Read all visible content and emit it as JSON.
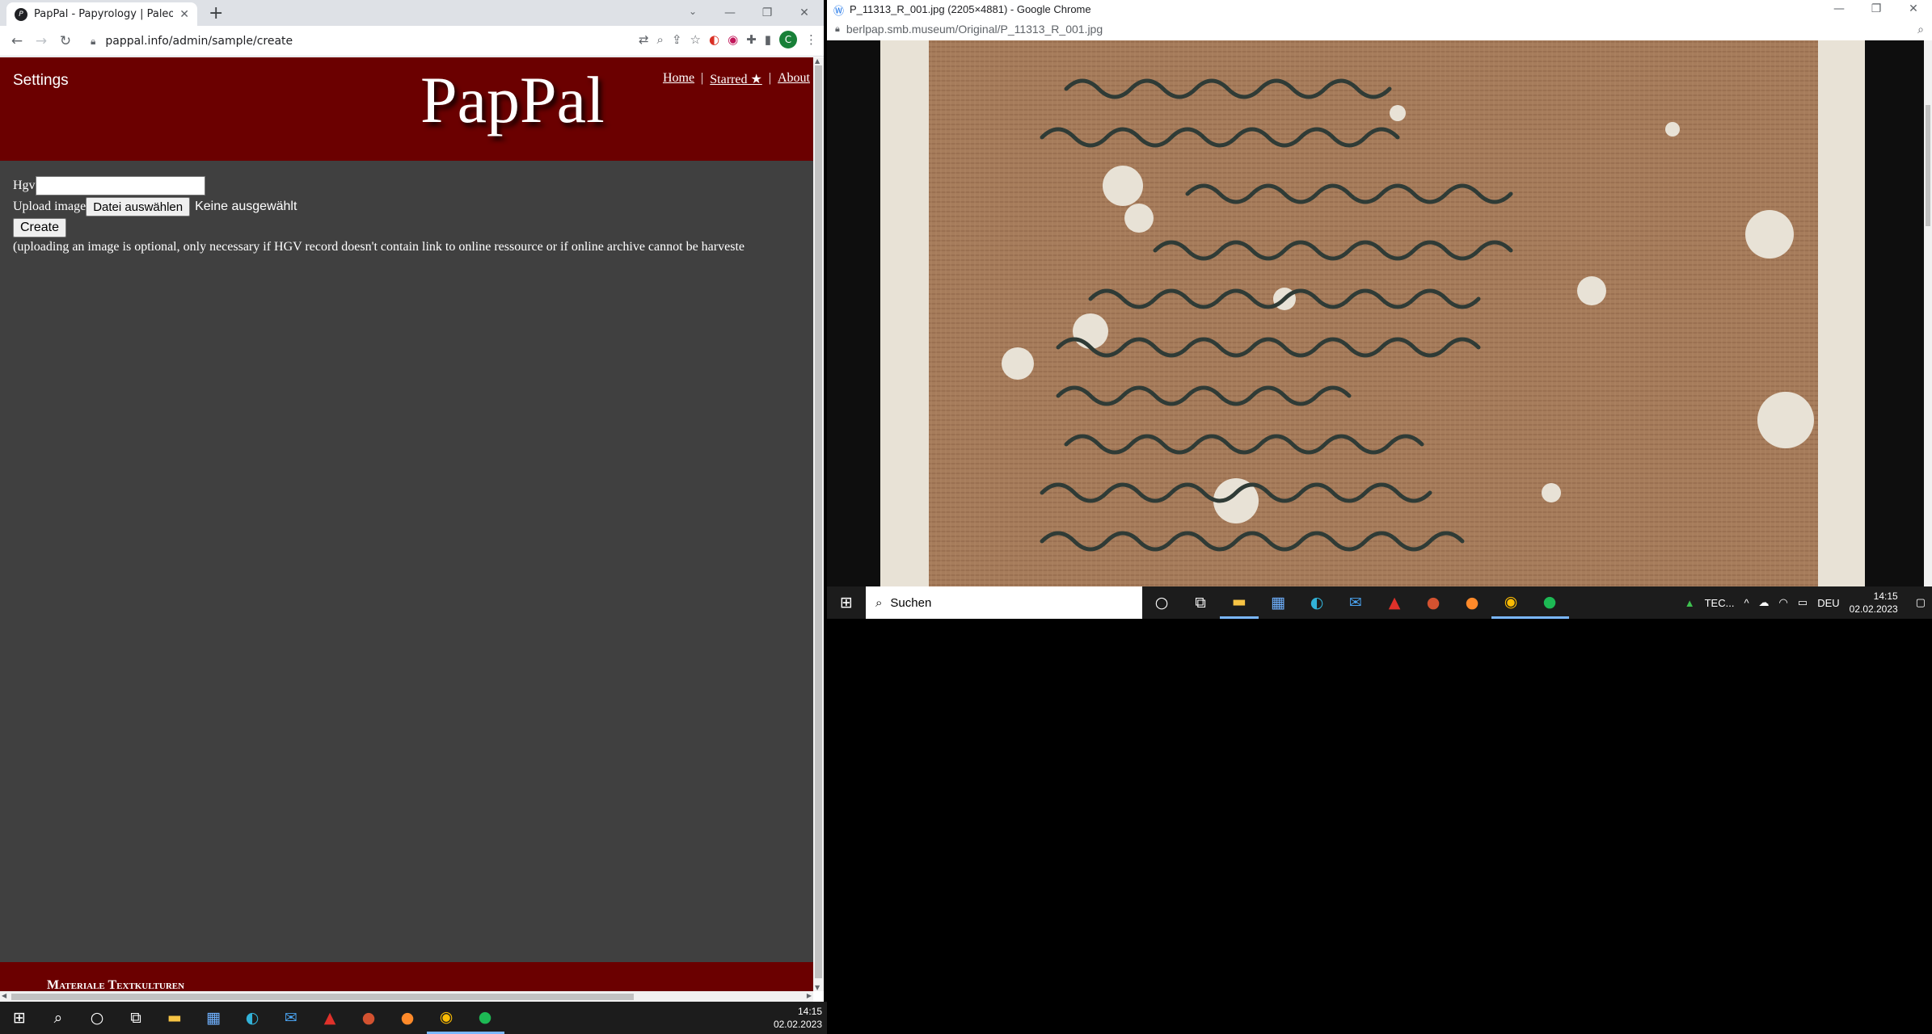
{
  "left_window": {
    "tab_title": "PapPal - Papyrology | Paleography",
    "url": "pappal.info/admin/sample/create",
    "page": {
      "settings_label": "Settings",
      "logo": "PapPal",
      "nav": [
        {
          "label": "Home"
        },
        {
          "label": "Starred ★"
        },
        {
          "label": "About"
        }
      ],
      "separator": "|",
      "hgv_label": "Hgv",
      "hgv_value": "",
      "upload_label": "Upload image",
      "file_button": "Datei auswählen",
      "file_status": "Keine ausgewählt",
      "create_button": "Create",
      "note": "(uploading an image is optional, only necessary if HGV record doesn't contain link to online ressource or if online archive cannot be harveste",
      "footer_text": "Materiale Textkulturen"
    },
    "profile_initial": "C"
  },
  "right_window": {
    "title": "P_11313_R_001.jpg (2205×4881) - Google Chrome",
    "url": "berlpap.smb.museum/Original/P_11313_R_001.jpg"
  },
  "right_taskbar": {
    "search_placeholder": "Suchen",
    "tray_app": "TEC...",
    "language": "DEU",
    "time": "14:15",
    "date": "02.02.2023"
  },
  "left_taskbar": {
    "time": "14:15",
    "date": "02.02.2023"
  },
  "colors": {
    "banner": "#6b0000",
    "page_bg": "#404040",
    "papyrus": "#a67c5b",
    "ink": "#2f3b36"
  }
}
